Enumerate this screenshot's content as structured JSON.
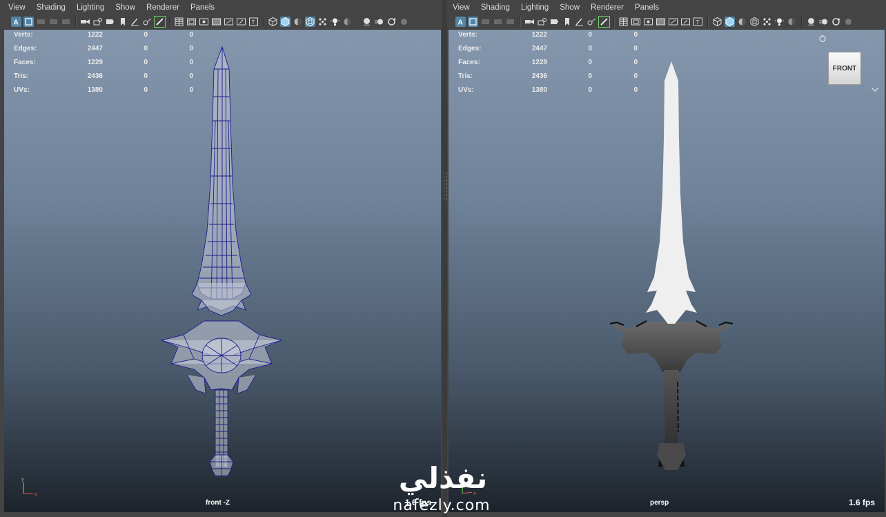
{
  "menus": [
    "View",
    "Shading",
    "Lighting",
    "Show",
    "Renderer",
    "Panels"
  ],
  "hud": {
    "rows": [
      {
        "label": "Verts:",
        "v1": "1222",
        "v2": "0",
        "v3": "0"
      },
      {
        "label": "Edges:",
        "v1": "2447",
        "v2": "0",
        "v3": "0"
      },
      {
        "label": "Faces:",
        "v1": "1229",
        "v2": "0",
        "v3": "0"
      },
      {
        "label": "Tris:",
        "v1": "2436",
        "v2": "0",
        "v3": "0"
      },
      {
        "label": "UVs:",
        "v1": "1380",
        "v2": "0",
        "v3": "0"
      }
    ]
  },
  "viewports": {
    "left": {
      "camera": "front -Z",
      "fps": "1.6 fps",
      "display_mode": "wireframe",
      "wire_color": "#1c1c8c"
    },
    "right": {
      "camera": "persp",
      "fps": "1.6 fps",
      "display_mode": "smooth-shaded",
      "viewcube_label": "FRONT"
    }
  },
  "watermark": {
    "arabic": "نفذلي",
    "latin": "nafezly.com"
  },
  "colors": {
    "accent": "#5285a6",
    "panel_bg": "#444444",
    "toggle_green": "#6ccf6c"
  }
}
